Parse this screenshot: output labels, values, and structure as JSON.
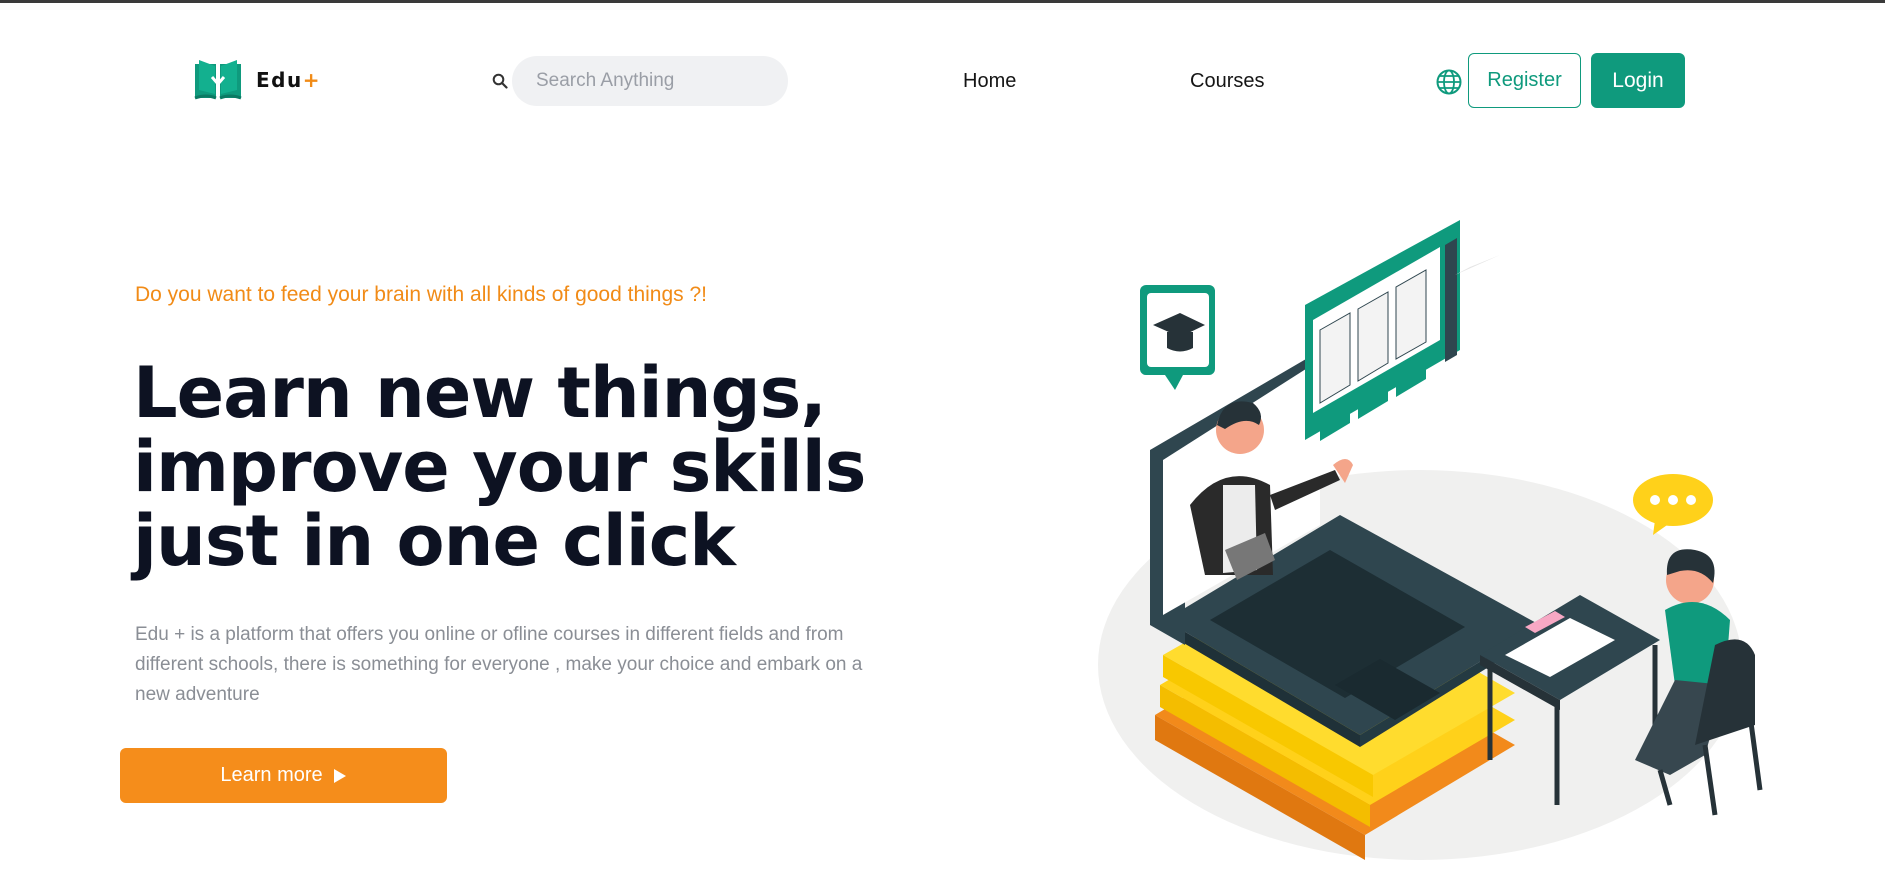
{
  "nav": {
    "brand_name": "Edu",
    "brand_plus": "+",
    "logo_icon": "book-download-icon",
    "search": {
      "icon": "search-icon",
      "placeholder": "Search Anything"
    },
    "links": [
      {
        "label": "Home"
      },
      {
        "label": "Courses"
      }
    ],
    "language_icon": "globe-icon",
    "register_label": "Register",
    "login_label": "Login"
  },
  "hero": {
    "tagline": "Do you want to feed your brain with all kinds of good things ?!",
    "headline_lines": [
      "Learn new things,",
      "improve your skills",
      "just in one click"
    ],
    "description": "Edu + is a platform that offers you online or ofline courses in different fields and from different schools, there is something for everyone , make your choice and embark on a new adventure",
    "cta_label": "Learn more",
    "cta_icon": "play-icon",
    "illustration": "online-learning-illustration"
  },
  "colors": {
    "primary": "#0f9a7d",
    "accent": "#f18b17",
    "text_dark": "#0d1222",
    "text_muted": "#8a8e95"
  }
}
